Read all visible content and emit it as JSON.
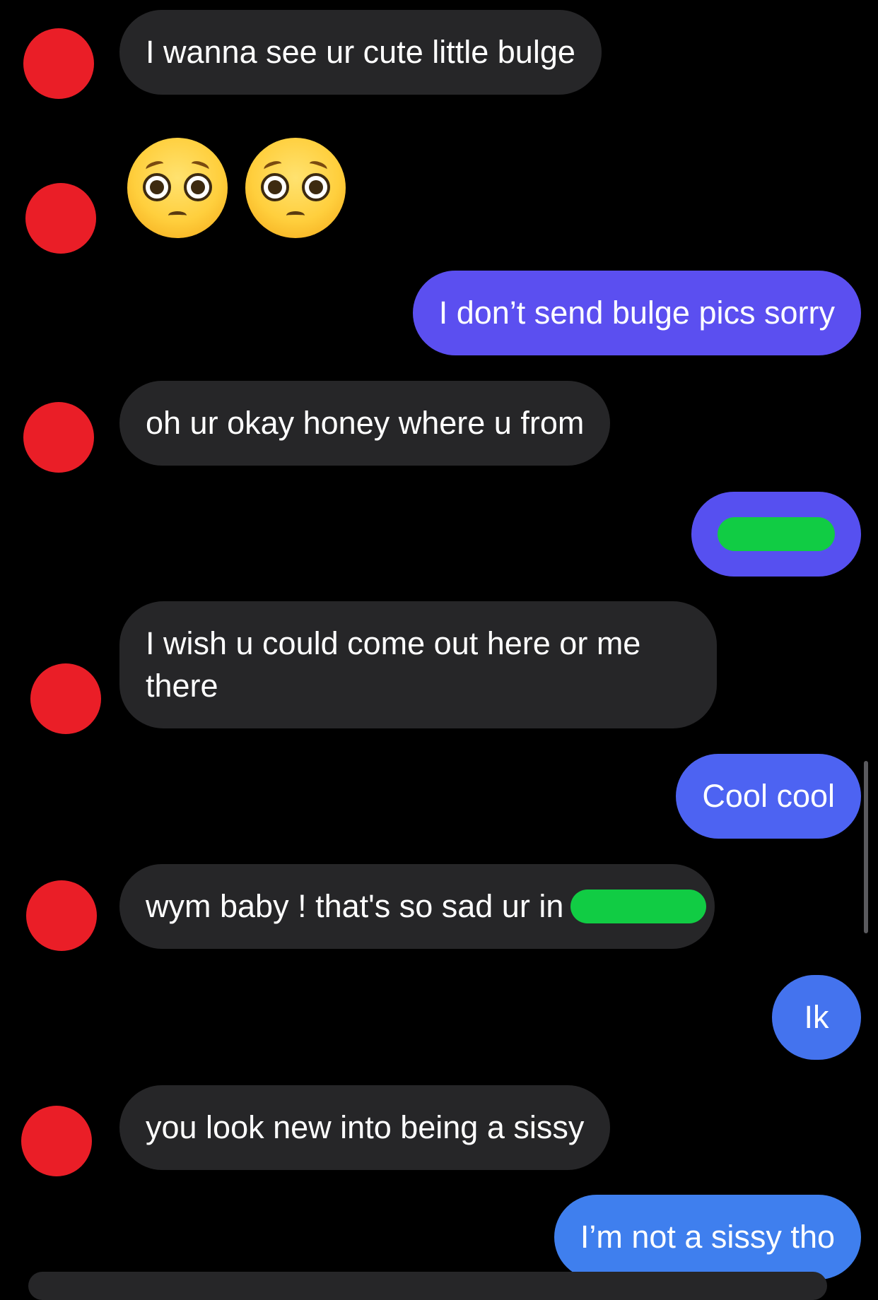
{
  "conversation": {
    "messages": [
      {
        "from": "them",
        "text": "I wanna see ur cute little bulge"
      },
      {
        "from": "them",
        "emoji": [
          "pleading-face",
          "pleading-face"
        ]
      },
      {
        "from": "me",
        "text": "I don’t send bulge pics sorry",
        "color": "#5b4ff0"
      },
      {
        "from": "them",
        "text": "oh ur okay honey where u from"
      },
      {
        "from": "me",
        "text": "",
        "redacted": true,
        "color": "#5650f0"
      },
      {
        "from": "them",
        "text": "I wish u could come out here or me there"
      },
      {
        "from": "me",
        "text": "Cool cool",
        "color": "#4d63f2"
      },
      {
        "from": "them",
        "text": "wym baby ! that's so sad ur in",
        "redacted_suffix": true
      },
      {
        "from": "me",
        "text": "Ik",
        "color": "#4473ee"
      },
      {
        "from": "them",
        "text": "you look new into being a sissy"
      },
      {
        "from": "me",
        "text": "I’m not a sissy tho",
        "color": "#3f7fee"
      }
    ]
  },
  "colors": {
    "background": "#000000",
    "incoming_bubble": "#262628",
    "avatar": "#ea1e27",
    "redaction": "#11cc44"
  }
}
